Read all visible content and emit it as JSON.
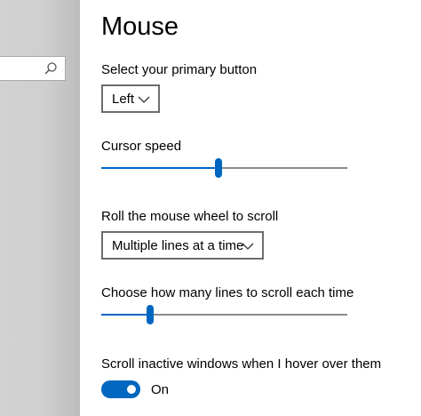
{
  "page": {
    "title": "Mouse"
  },
  "sidebar": {
    "search": {
      "placeholder": "",
      "icon": "search-icon"
    }
  },
  "primary_button": {
    "label": "Select your primary button",
    "selected": "Left"
  },
  "cursor_speed": {
    "label": "Cursor speed",
    "value_fraction": 0.475
  },
  "scroll_mode": {
    "label": "Roll the mouse wheel to scroll",
    "selected": "Multiple lines at a time"
  },
  "scroll_lines": {
    "label": "Choose how many lines to scroll each time",
    "value_fraction": 0.2
  },
  "inactive_scroll": {
    "label": "Scroll inactive windows when I hover over them",
    "state_text": "On",
    "enabled": true
  },
  "colors": {
    "accent": "#0067c0",
    "track": "#8a8a8a",
    "sidebar": "#cfcfcf"
  }
}
